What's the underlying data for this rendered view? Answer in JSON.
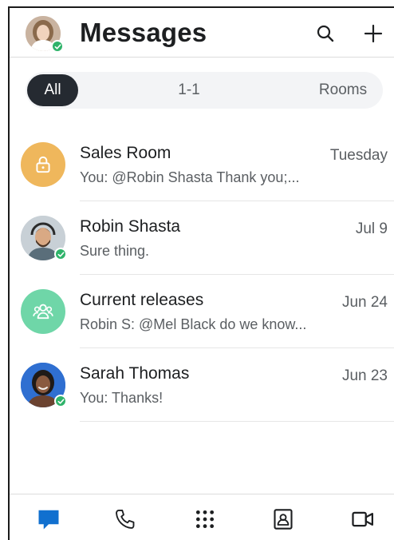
{
  "header": {
    "title": "Messages",
    "search_icon": "search-icon",
    "add_icon": "plus-icon"
  },
  "filters": [
    {
      "label": "All",
      "active": true
    },
    {
      "label": "1-1",
      "active": false
    },
    {
      "label": "Rooms",
      "active": false
    }
  ],
  "conversations": [
    {
      "name": "Sales Room",
      "preview": "You: @Robin Shasta Thank you;...",
      "time": "Tuesday",
      "avatar": "lock-icon",
      "avatar_color": "#efb75c",
      "presence": false
    },
    {
      "name": "Robin Shasta",
      "preview": "Sure thing.",
      "time": "Jul 9",
      "avatar": "person-photo",
      "presence": true
    },
    {
      "name": "Current releases",
      "preview": "Robin S: @Mel Black do we know...",
      "time": "Jun 24",
      "avatar": "group-icon",
      "avatar_color": "#6fd6a8",
      "presence": false
    },
    {
      "name": "Sarah Thomas",
      "preview": "You: Thanks!",
      "time": "Jun 23",
      "avatar": "person-photo",
      "presence": true
    }
  ],
  "tabbar": [
    {
      "icon": "message-icon",
      "active": true
    },
    {
      "icon": "phone-icon",
      "active": false
    },
    {
      "icon": "apps-grid-icon",
      "active": false
    },
    {
      "icon": "contacts-icon",
      "active": false
    },
    {
      "icon": "video-icon",
      "active": false
    }
  ],
  "colors": {
    "accent": "#1170cf",
    "presence": "#2fb36a",
    "filter_active_bg": "#252a31"
  }
}
